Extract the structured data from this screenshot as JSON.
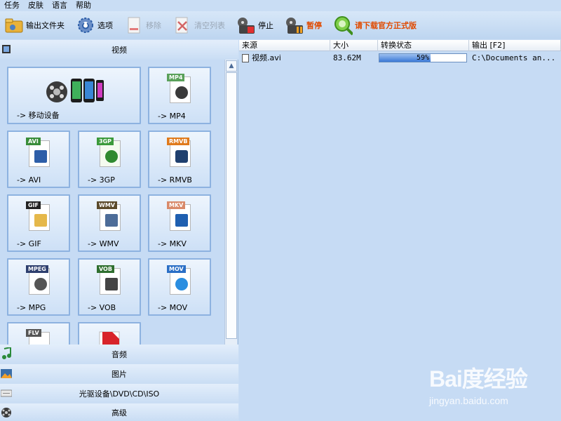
{
  "menu": [
    "任务",
    "皮肤",
    "语言",
    "帮助"
  ],
  "toolbar": {
    "output_folder": "输出文件夹",
    "options": "选项",
    "remove": "移除",
    "clear_list": "清空列表",
    "stop": "停止",
    "pause": "暂停",
    "download": "请下载官方正式版"
  },
  "sections": {
    "video": "视频",
    "audio": "音频",
    "picture": "图片",
    "disc": "光驱设备\\DVD\\CD\\ISO",
    "advanced": "高级"
  },
  "tiles": [
    {
      "label": "-> 移动设备",
      "tag": "",
      "icon": "mobile-device-icon"
    },
    {
      "label": "-> MP4",
      "tag": "MP4",
      "icon": "mp4-file-icon"
    },
    {
      "label": "-> AVI",
      "tag": "AVI",
      "icon": "avi-file-icon"
    },
    {
      "label": "-> 3GP",
      "tag": "3GP",
      "icon": "3gp-file-icon"
    },
    {
      "label": "-> RMVB",
      "tag": "RMVB",
      "icon": "rmvb-file-icon"
    },
    {
      "label": "-> GIF",
      "tag": "GIF",
      "icon": "gif-file-icon"
    },
    {
      "label": "-> WMV",
      "tag": "WMV",
      "icon": "wmv-file-icon"
    },
    {
      "label": "-> MKV",
      "tag": "MKV",
      "icon": "mkv-file-icon"
    },
    {
      "label": "-> MPG",
      "tag": "MPEG",
      "icon": "mpg-file-icon"
    },
    {
      "label": "-> VOB",
      "tag": "VOB",
      "icon": "vob-file-icon"
    },
    {
      "label": "-> MOV",
      "tag": "MOV",
      "icon": "mov-file-icon"
    },
    {
      "label": "",
      "tag": "FLV",
      "icon": "flv-file-icon"
    },
    {
      "label": "",
      "tag": "",
      "icon": "swf-file-icon"
    }
  ],
  "table": {
    "headers": [
      "来源",
      "大小",
      "转换状态",
      "输出 [F2]"
    ],
    "rows": [
      {
        "source": "视频.avi",
        "size": "83.62M",
        "progress": 59,
        "progress_text": "59%",
        "output": "C:\\Documents an..."
      }
    ]
  },
  "watermark": {
    "brand": "Bai度经验",
    "url": "jingyan.baidu.com"
  },
  "colors": {
    "accent": "#3a78d7",
    "highlight": "#e04a00",
    "panel": "#c6dbf4"
  }
}
